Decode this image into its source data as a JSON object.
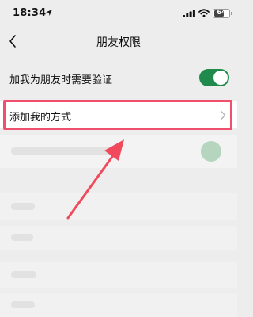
{
  "status_bar": {
    "time": "18:34",
    "battery": "64",
    "battery_fraction": 0.64
  },
  "nav": {
    "title": "朋友权限",
    "back_icon": "chevron-left-icon"
  },
  "settings": {
    "verify_label": "加我为朋友时需要验证",
    "verify_enabled": true,
    "add_methods_label": "添加我的方式"
  },
  "colors": {
    "toggle_on": "#1f8a4c",
    "highlight": "#f0506e",
    "arrow": "#f04a5c"
  }
}
